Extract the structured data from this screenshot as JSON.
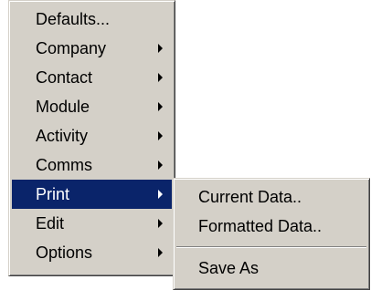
{
  "main_menu": {
    "items": [
      {
        "label": "Defaults...",
        "submenu_arrow": false
      },
      {
        "label": "Company",
        "submenu_arrow": true
      },
      {
        "label": "Contact",
        "submenu_arrow": true
      },
      {
        "label": "Module",
        "submenu_arrow": true
      },
      {
        "label": "Activity",
        "submenu_arrow": true
      },
      {
        "label": "Comms",
        "submenu_arrow": true
      },
      {
        "label": "Print",
        "submenu_arrow": true,
        "selected": true
      },
      {
        "label": "Edit",
        "submenu_arrow": true
      },
      {
        "label": "Options",
        "submenu_arrow": true
      }
    ]
  },
  "print_submenu": {
    "items": [
      {
        "label": "Current Data.."
      },
      {
        "label": "Formatted Data.."
      },
      {
        "label": "Save As"
      }
    ]
  },
  "colors": {
    "menu_background": "#d4d0c8",
    "highlight": "#0a246a",
    "highlight_text": "#ffffff"
  },
  "icons": {
    "submenu_arrow": "triangle-right-icon"
  }
}
